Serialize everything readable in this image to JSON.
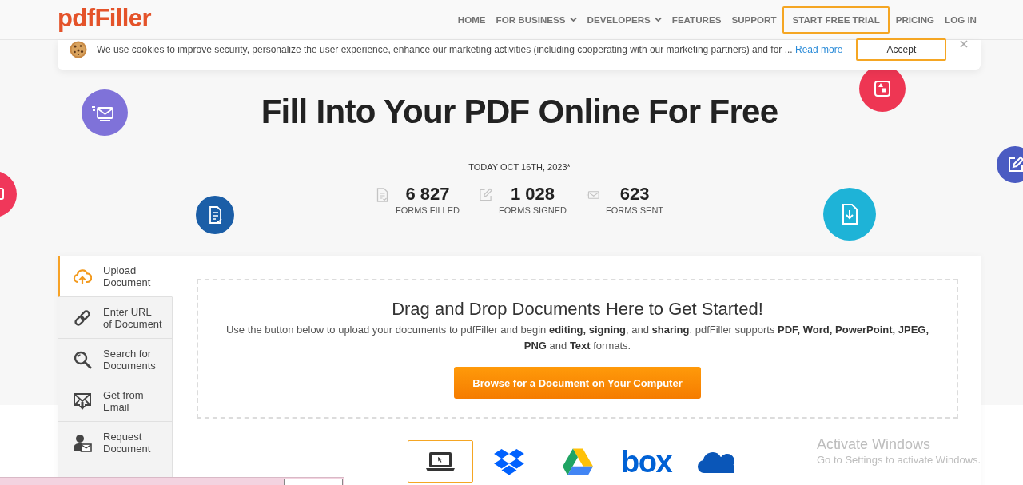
{
  "header": {
    "logo": "pdfFiller",
    "nav": [
      {
        "label": "HOME",
        "has_menu": false,
        "outlined": false
      },
      {
        "label": "FOR BUSINESS",
        "has_menu": true,
        "outlined": false
      },
      {
        "label": "DEVELOPERS",
        "has_menu": true,
        "outlined": false
      },
      {
        "label": "FEATURES",
        "has_menu": false,
        "outlined": false
      },
      {
        "label": "SUPPORT",
        "has_menu": false,
        "outlined": false
      },
      {
        "label": "START FREE TRIAL",
        "has_menu": false,
        "outlined": true
      },
      {
        "label": "PRICING",
        "has_menu": false,
        "outlined": false
      },
      {
        "label": "LOG IN",
        "has_menu": false,
        "outlined": false
      }
    ]
  },
  "cookie_notice": {
    "text": "We use cookies to improve security, personalize the user experience, enhance our marketing activities (including cooperating with our marketing partners) and for ...",
    "link": "Read more",
    "accept": "Accept"
  },
  "hero": {
    "title": "Fill Into Your PDF Online For Free",
    "date": "TODAY OCT 16TH, 2023*",
    "stats": [
      {
        "value": "6 827",
        "label": "FORMS FILLED"
      },
      {
        "value": "1 028",
        "label": "FORMS SIGNED"
      },
      {
        "value": "623",
        "label": "FORMS SENT"
      }
    ]
  },
  "upload": {
    "tabs": [
      {
        "label": "Upload Document",
        "selected": true
      },
      {
        "label": "Enter URL of Document",
        "selected": false
      },
      {
        "label": "Search for Documents",
        "selected": false
      },
      {
        "label": "Get from Email",
        "selected": false
      },
      {
        "label": "Request Document",
        "selected": false
      }
    ],
    "dropzone": {
      "title": "Drag and Drop Documents Here to Get Started!",
      "text": "Use the button below to upload your documents to pdfFiller and begin **editing, signing**, and **sharing**. pdfFiller supports **PDF, Word, PowerPoint, JPEG, PNG** and **Text** formats.",
      "button": "Browse for a Document on Your Computer"
    },
    "sources": [
      {
        "selected": true
      },
      {
        "selected": false
      },
      {
        "selected": false
      },
      {
        "selected": false,
        "label": "box"
      },
      {
        "selected": false
      }
    ]
  },
  "os_overlay": {
    "title": "Activate Windows",
    "text": "Go to Settings to activate Windows."
  }
}
